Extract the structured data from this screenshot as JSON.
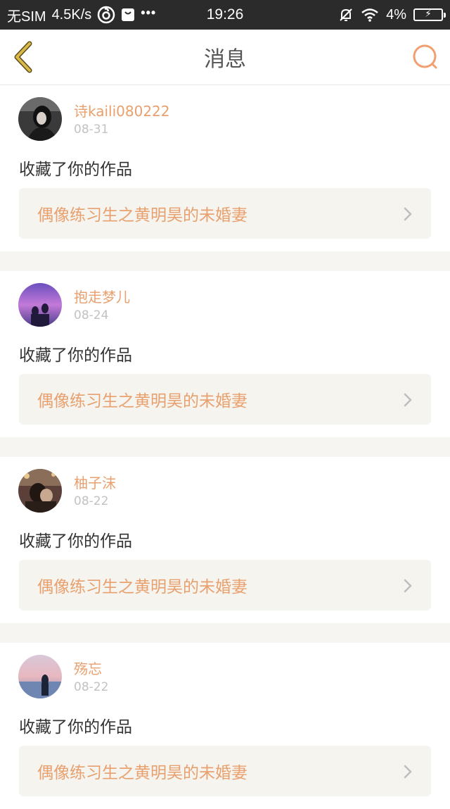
{
  "status_bar": {
    "carrier": "无SIM",
    "speed": "4.5K/s",
    "time": "19:26",
    "battery": "4%"
  },
  "nav": {
    "title": "消息"
  },
  "colors": {
    "accent": "#e8a06e",
    "back_arrow": "#d8b94a",
    "card_bg": "#f5f4ef",
    "separator": "#f6f5f1"
  },
  "messages": [
    {
      "username": "诗kaili080222",
      "date": "08-31",
      "action": "收藏了你的作品",
      "work_title": "偶像练习生之黄明昊的未婚妻"
    },
    {
      "username": "抱走梦儿",
      "date": "08-24",
      "action": "收藏了你的作品",
      "work_title": "偶像练习生之黄明昊的未婚妻"
    },
    {
      "username": "柚子沫",
      "date": "08-22",
      "action": "收藏了你的作品",
      "work_title": "偶像练习生之黄明昊的未婚妻"
    },
    {
      "username": "殇忘",
      "date": "08-22",
      "action": "收藏了你的作品",
      "work_title": "偶像练习生之黄明昊的未婚妻"
    }
  ]
}
